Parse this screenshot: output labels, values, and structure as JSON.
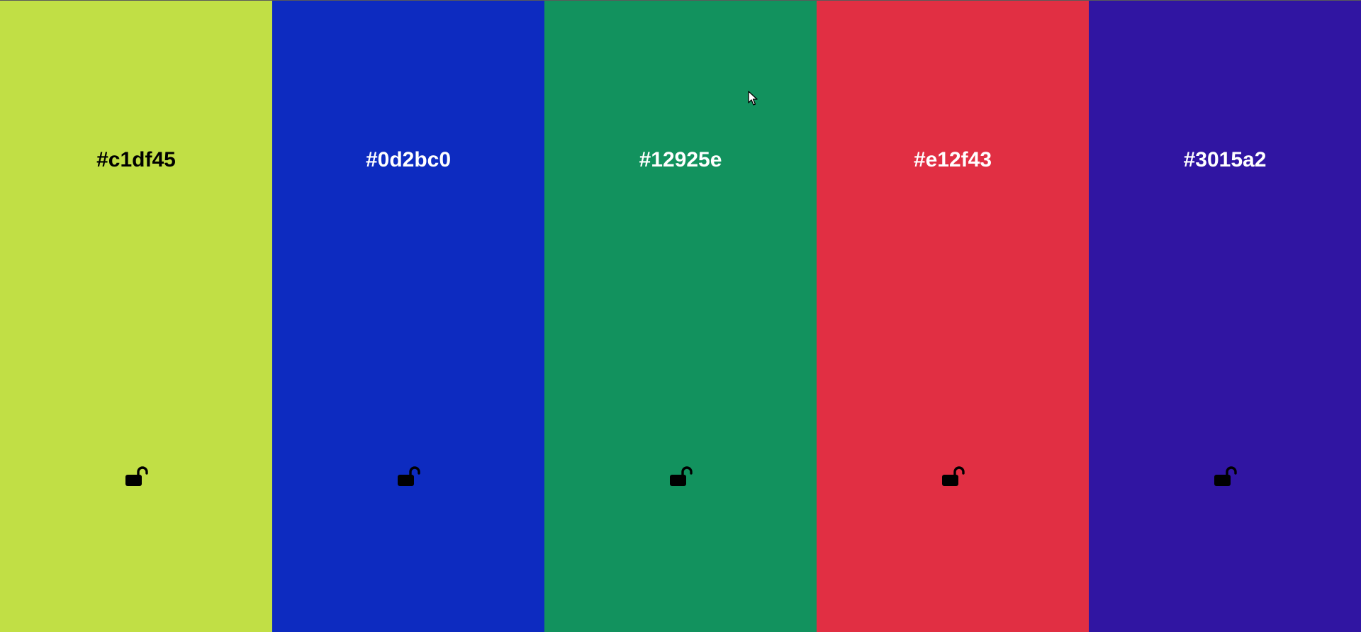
{
  "swatches": [
    {
      "hex": "#c1df45",
      "background": "#c1df45",
      "text_color": "#000000",
      "lock_icon": "unlocked-padlock-icon",
      "locked": false
    },
    {
      "hex": "#0d2bc0",
      "background": "#0d2bc0",
      "text_color": "#ffffff",
      "lock_icon": "unlocked-padlock-icon",
      "locked": false
    },
    {
      "hex": "#12925e",
      "background": "#12925e",
      "text_color": "#ffffff",
      "lock_icon": "unlocked-padlock-icon",
      "locked": false
    },
    {
      "hex": "#e12f43",
      "background": "#e12f43",
      "text_color": "#ffffff",
      "lock_icon": "unlocked-padlock-icon",
      "locked": false
    },
    {
      "hex": "#3015a2",
      "background": "#3015a2",
      "text_color": "#ffffff",
      "lock_icon": "unlocked-padlock-icon",
      "locked": false
    }
  ],
  "cursor_icon": "mouse-pointer-icon"
}
